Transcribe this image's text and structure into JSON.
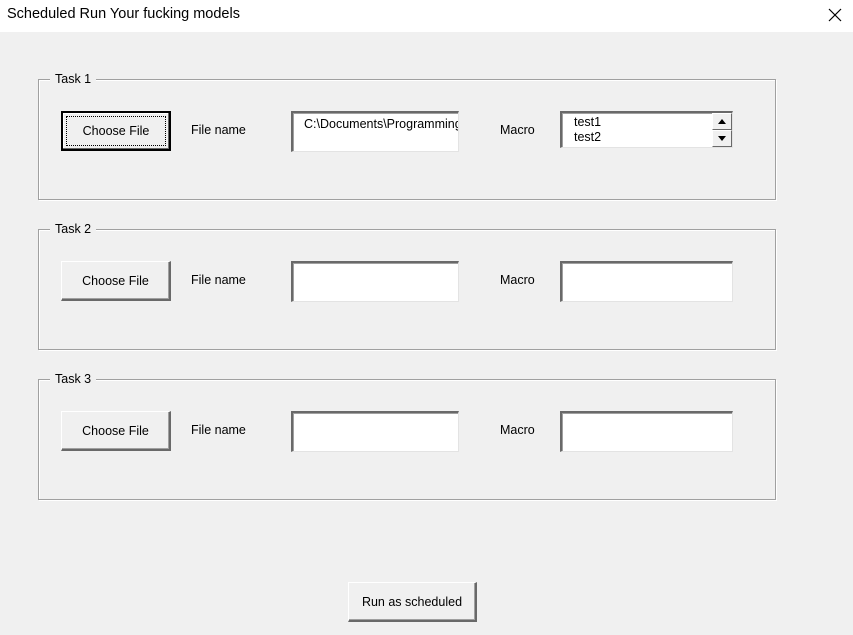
{
  "window": {
    "title": "Scheduled Run Your fucking models",
    "close_icon": "close-icon"
  },
  "tasks": [
    {
      "legend": "Task 1",
      "choose_label": "Choose File",
      "file_label": "File name",
      "file_value": "C:\\Documents\\Programming\\",
      "macro_label": "Macro",
      "macro_items": [
        "test1",
        "test2"
      ]
    },
    {
      "legend": "Task 2",
      "choose_label": "Choose File",
      "file_label": "File name",
      "file_value": "",
      "macro_label": "Macro",
      "macro_items": []
    },
    {
      "legend": "Task 3",
      "choose_label": "Choose File",
      "file_label": "File name",
      "file_value": "",
      "macro_label": "Macro",
      "macro_items": []
    }
  ],
  "footer": {
    "run_label": "Run as scheduled"
  },
  "icons": {
    "scroll_up": "chevron-up-icon",
    "scroll_down": "chevron-down-icon"
  }
}
